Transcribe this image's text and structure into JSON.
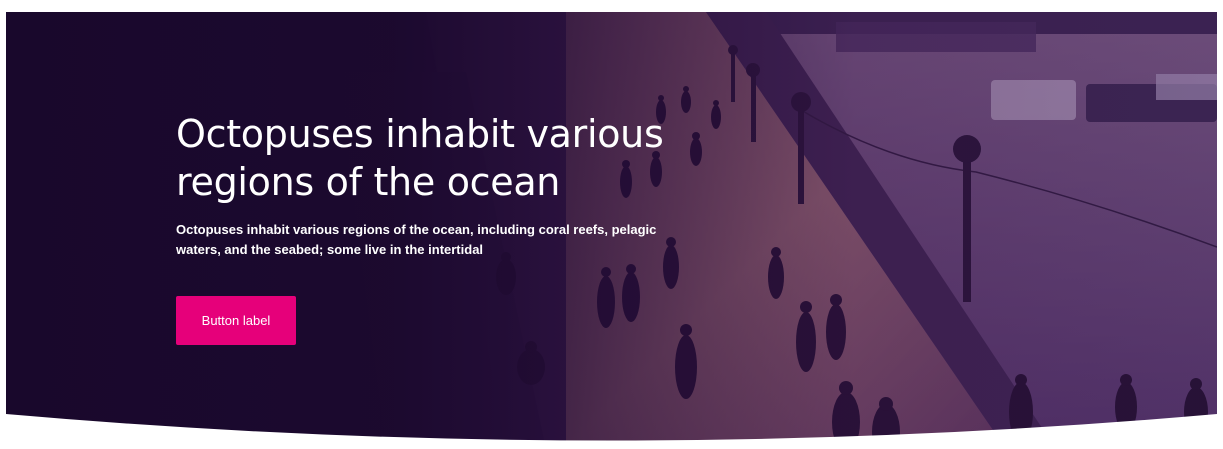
{
  "hero": {
    "title": "Octopuses inhabit various regions of the ocean",
    "subtitle": "Octopuses inhabit various regions of the ocean, including coral reefs, pelagic waters, and the seabed; some live in the intertidal",
    "button_label": "Button label",
    "background_image": "photo of people walking along a riverside promenade with lampposts and boats on the water",
    "colors": {
      "overlay": "#1f0c33",
      "button": "#e6007a",
      "text": "#ffffff"
    }
  }
}
